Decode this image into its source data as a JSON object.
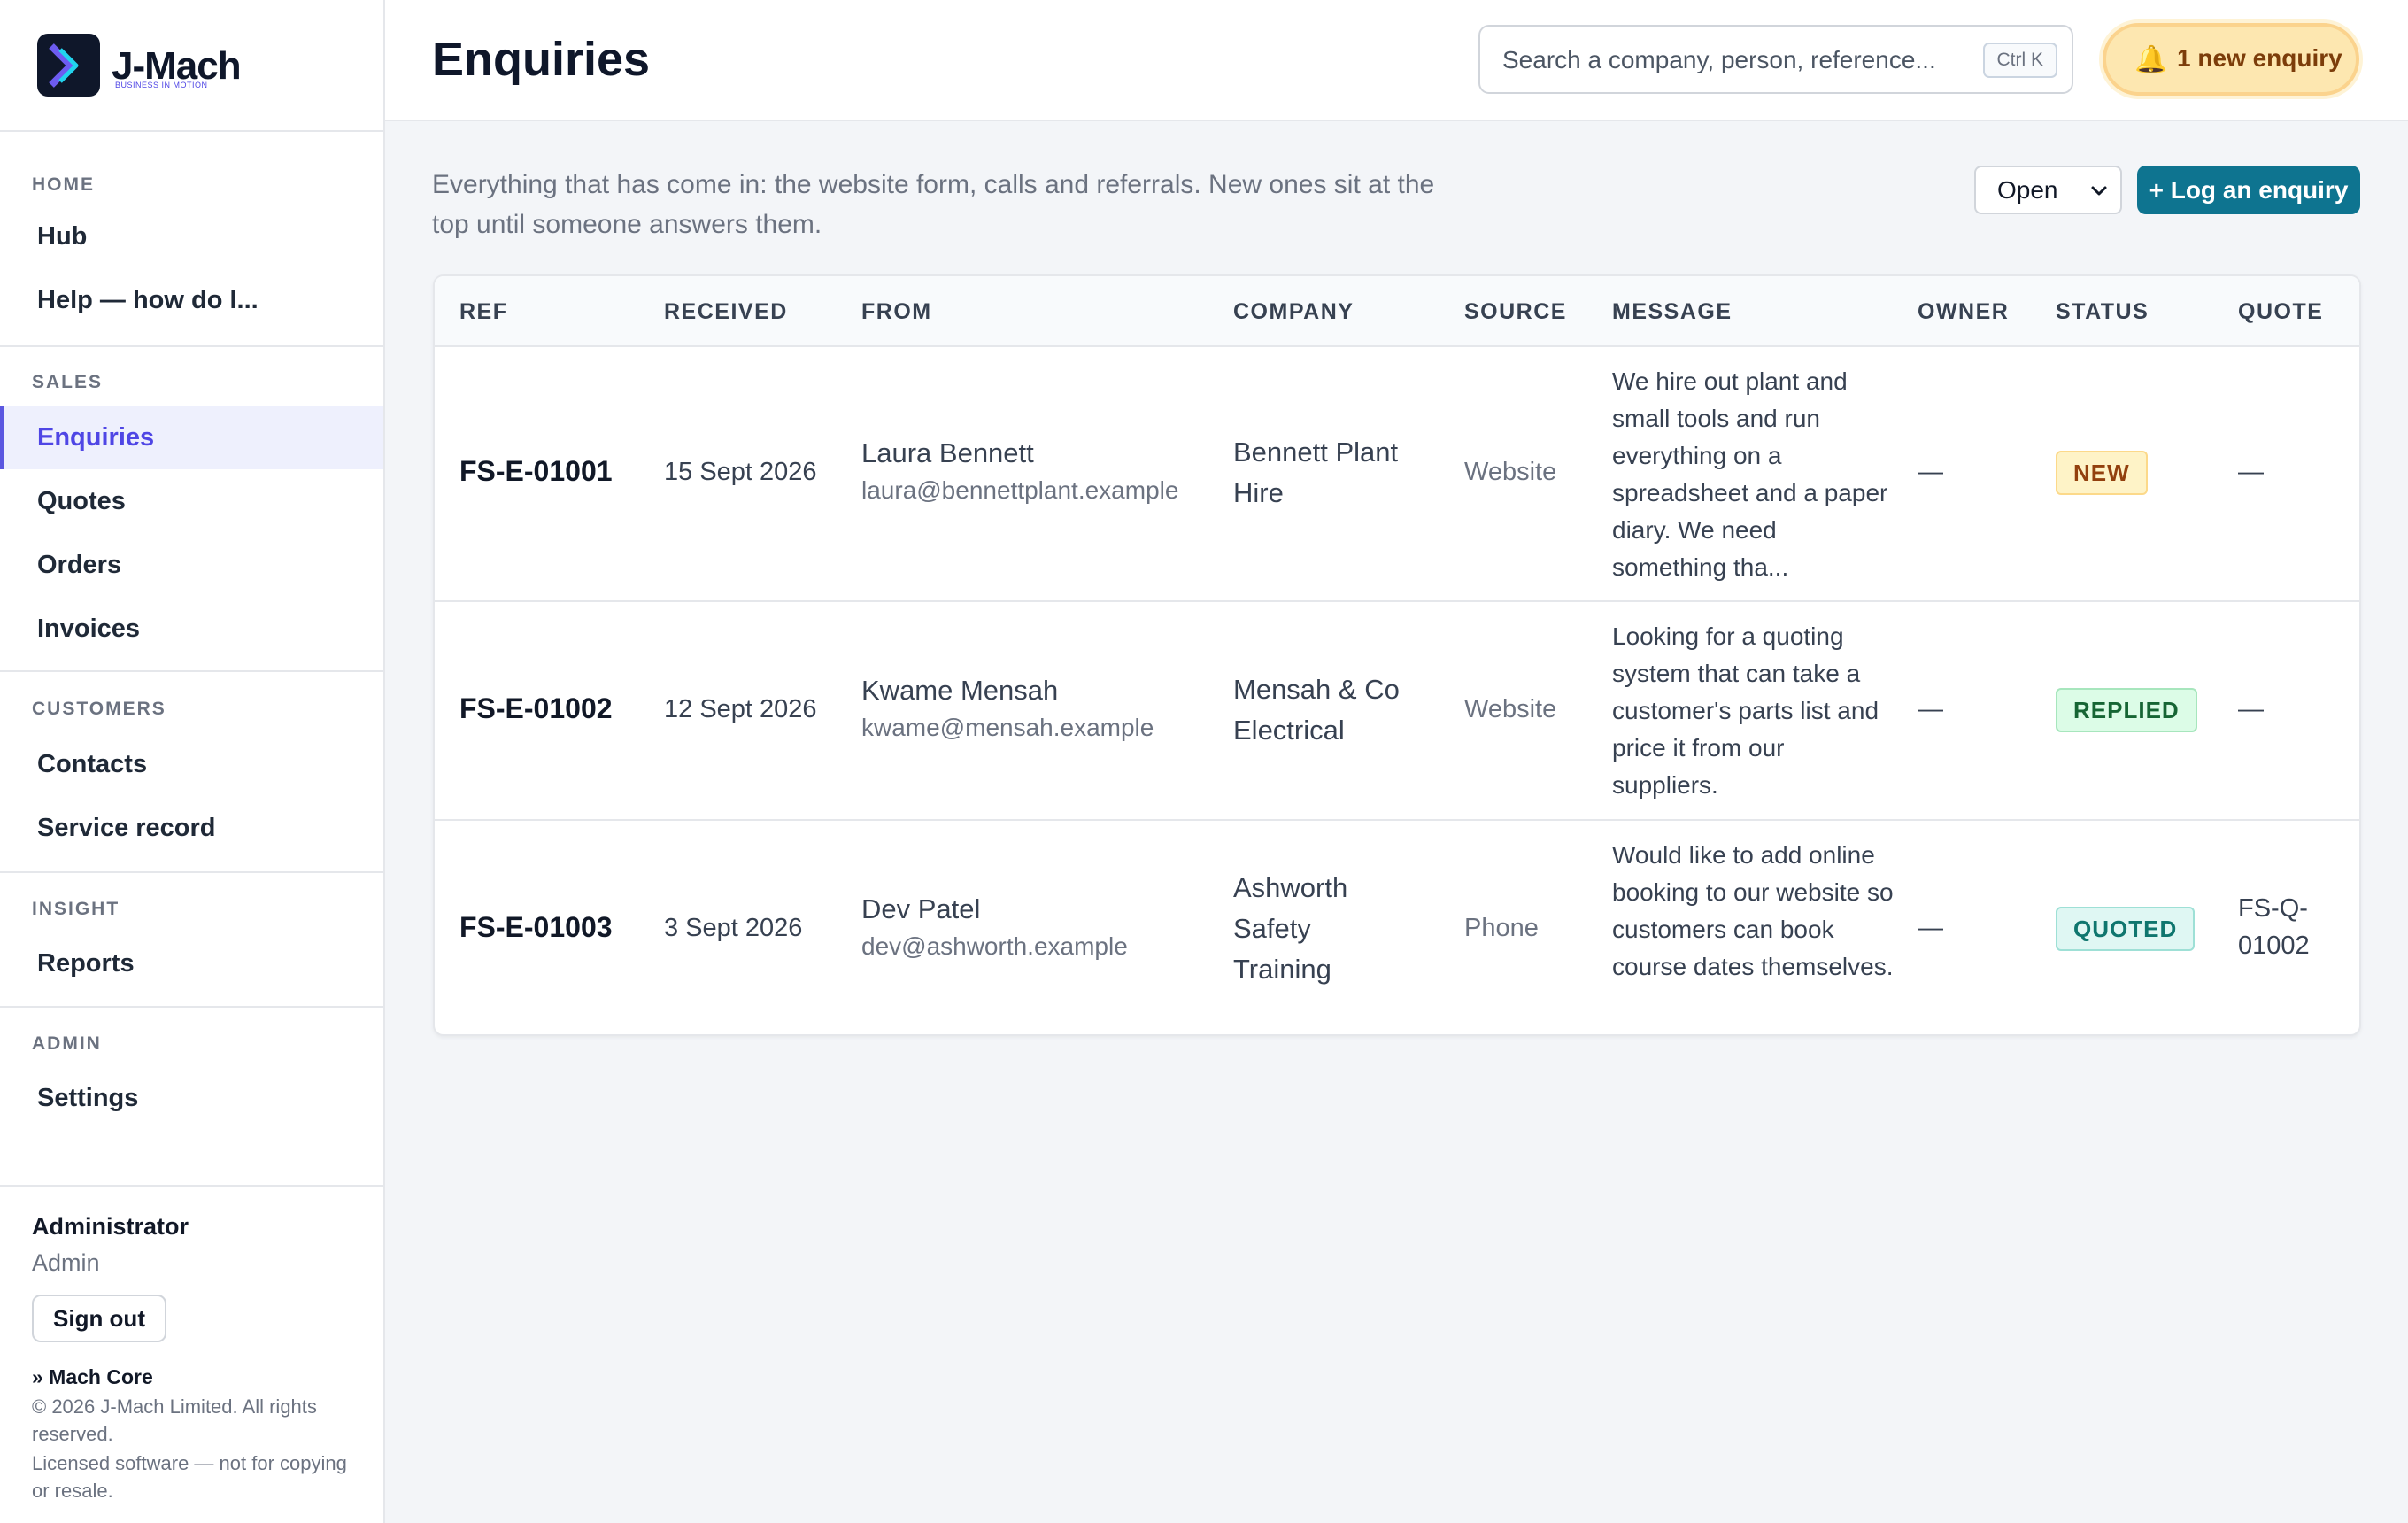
{
  "brand": {
    "name": "J-Mach",
    "tagline": "BUSINESS IN MOTION"
  },
  "sidebar": {
    "sections": [
      {
        "heading": "HOME",
        "items": [
          "Hub",
          "Help — how do I..."
        ]
      },
      {
        "heading": "SALES",
        "items": [
          "Enquiries",
          "Quotes",
          "Orders",
          "Invoices"
        ]
      },
      {
        "heading": "CUSTOMERS",
        "items": [
          "Contacts",
          "Service record"
        ]
      },
      {
        "heading": "INSIGHT",
        "items": [
          "Reports"
        ]
      },
      {
        "heading": "ADMIN",
        "items": [
          "Settings"
        ]
      }
    ],
    "active_item": "Enquiries"
  },
  "user": {
    "name": "Administrator",
    "role": "Admin",
    "sign_out": "Sign out"
  },
  "footer": {
    "product": "» Mach Core",
    "copyright": "© 2026 J-Mach Limited. All rights reserved.",
    "license": "Licensed software — not for copying or resale."
  },
  "header": {
    "title": "Enquiries",
    "search_placeholder": "Search a company, person, reference...",
    "search_shortcut": "Ctrl K",
    "notification": "1 new enquiry"
  },
  "main": {
    "intro": "Everything that has come in: the website form, calls and referrals. New ones sit at the top until someone answers them.",
    "filter_value": "Open",
    "log_button": "+ Log an enquiry"
  },
  "table": {
    "columns": [
      "REF",
      "RECEIVED",
      "FROM",
      "COMPANY",
      "SOURCE",
      "MESSAGE",
      "OWNER",
      "STATUS",
      "QUOTE"
    ],
    "rows": [
      {
        "ref": "FS-E-01001",
        "received": "15 Sept 2026",
        "from_name": "Laura Bennett",
        "from_email": "laura@bennettplant.example",
        "company": "Bennett Plant Hire",
        "source": "Website",
        "message": "We hire out plant and small tools and run everything on a spreadsheet and a paper diary. We need something tha...",
        "owner": "—",
        "status": "NEW",
        "quote": "—"
      },
      {
        "ref": "FS-E-01002",
        "received": "12 Sept 2026",
        "from_name": "Kwame Mensah",
        "from_email": "kwame@mensah.example",
        "company": "Mensah & Co Electrical",
        "source": "Website",
        "message": "Looking for a quoting system that can take a customer's parts list and price it from our suppliers.",
        "owner": "—",
        "status": "REPLIED",
        "quote": "—"
      },
      {
        "ref": "FS-E-01003",
        "received": "3 Sept 2026",
        "from_name": "Dev Patel",
        "from_email": "dev@ashworth.example",
        "company": "Ashworth Safety Training",
        "source": "Phone",
        "message": "Would like to add online booking to our website so customers can book course dates themselves.",
        "owner": "—",
        "status": "QUOTED",
        "quote": "FS-Q-01002"
      }
    ]
  },
  "colors": {
    "accent": "#4f46e5",
    "primary_button": "#0e7490",
    "notification_bg": "#fde7b0"
  }
}
